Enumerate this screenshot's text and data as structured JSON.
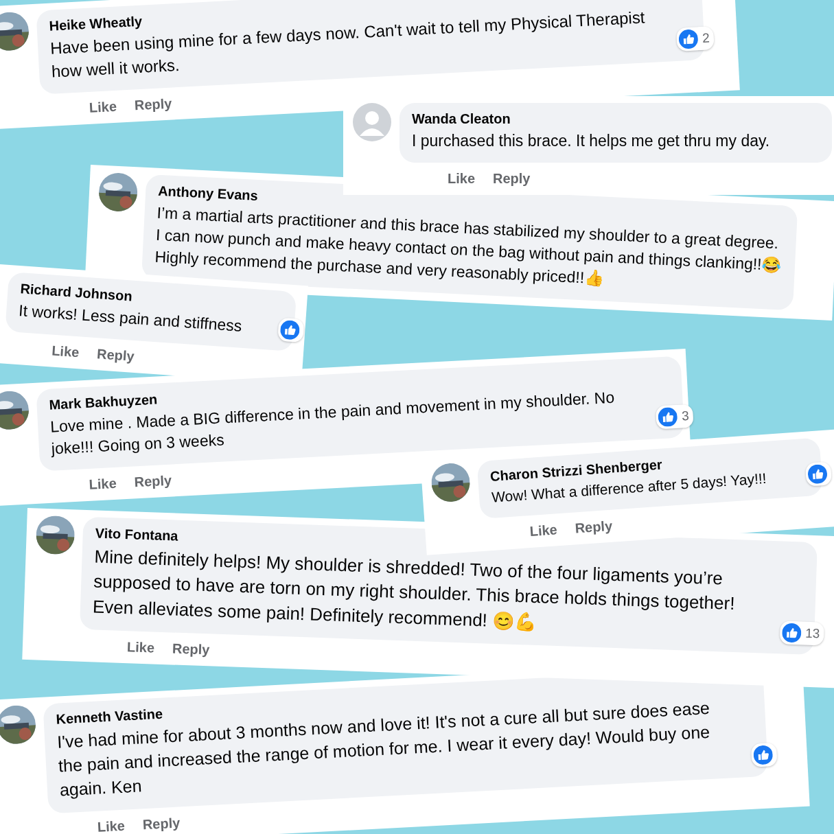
{
  "comments": [
    {
      "author": "Heike Wheatly",
      "text": "Have been using mine for a few days now. Can't wait to tell my Physical Therapist how well it works.",
      "photo_avatar": true,
      "liked": true,
      "like_count": "2",
      "actions": [
        "Like",
        "Reply"
      ]
    },
    {
      "author": "Wanda Cleaton",
      "text": "I purchased this brace. It helps me get thru my day.",
      "photo_avatar": false,
      "liked": false,
      "actions": [
        "Like",
        "Reply"
      ]
    },
    {
      "author": "Anthony Evans",
      "text": "I’m a martial arts practitioner and this brace has stabilized my shoulder to a great degree. I can now punch and make heavy contact on the bag without pain and things clanking!!😂 Highly recommend the purchase and very reasonably priced!!👍",
      "photo_avatar": true,
      "liked": false
    },
    {
      "author": "Richard Johnson",
      "text": "It works! Less pain and stiffness",
      "liked": true,
      "actions": [
        "Like",
        "Reply"
      ]
    },
    {
      "author": "Mark Bakhuyzen",
      "text": "Love mine . Made a BIG difference in the pain and movement in my shoulder. No joke!!! Going on 3 weeks",
      "photo_avatar": true,
      "liked": true,
      "like_count": "3",
      "actions": [
        "Like",
        "Reply"
      ]
    },
    {
      "author": "Charon Strizzi Shenberger",
      "text": "Wow! What a difference after 5 days! Yay!!!",
      "photo_avatar": true,
      "liked": true,
      "actions": [
        "Like",
        "Reply"
      ]
    },
    {
      "author": "Vito Fontana",
      "text": "Mine definitely helps! My shoulder is shredded! Two of the four ligaments you’re supposed to have are torn on my right shoulder. This brace holds things together! Even alleviates some pain! Definitely recommend! 😊💪",
      "photo_avatar": true,
      "liked": true,
      "like_count": "13",
      "actions": [
        "Like",
        "Reply"
      ]
    },
    {
      "author": "Kenneth Vastine",
      "text": "I've had mine for about 3 months now and love it! It's not a cure all but sure does ease the pain and increased the range of motion for me. I wear it every day! Would buy one again. Ken",
      "photo_avatar": true,
      "liked": true,
      "actions": [
        "Like",
        "Reply"
      ]
    }
  ]
}
